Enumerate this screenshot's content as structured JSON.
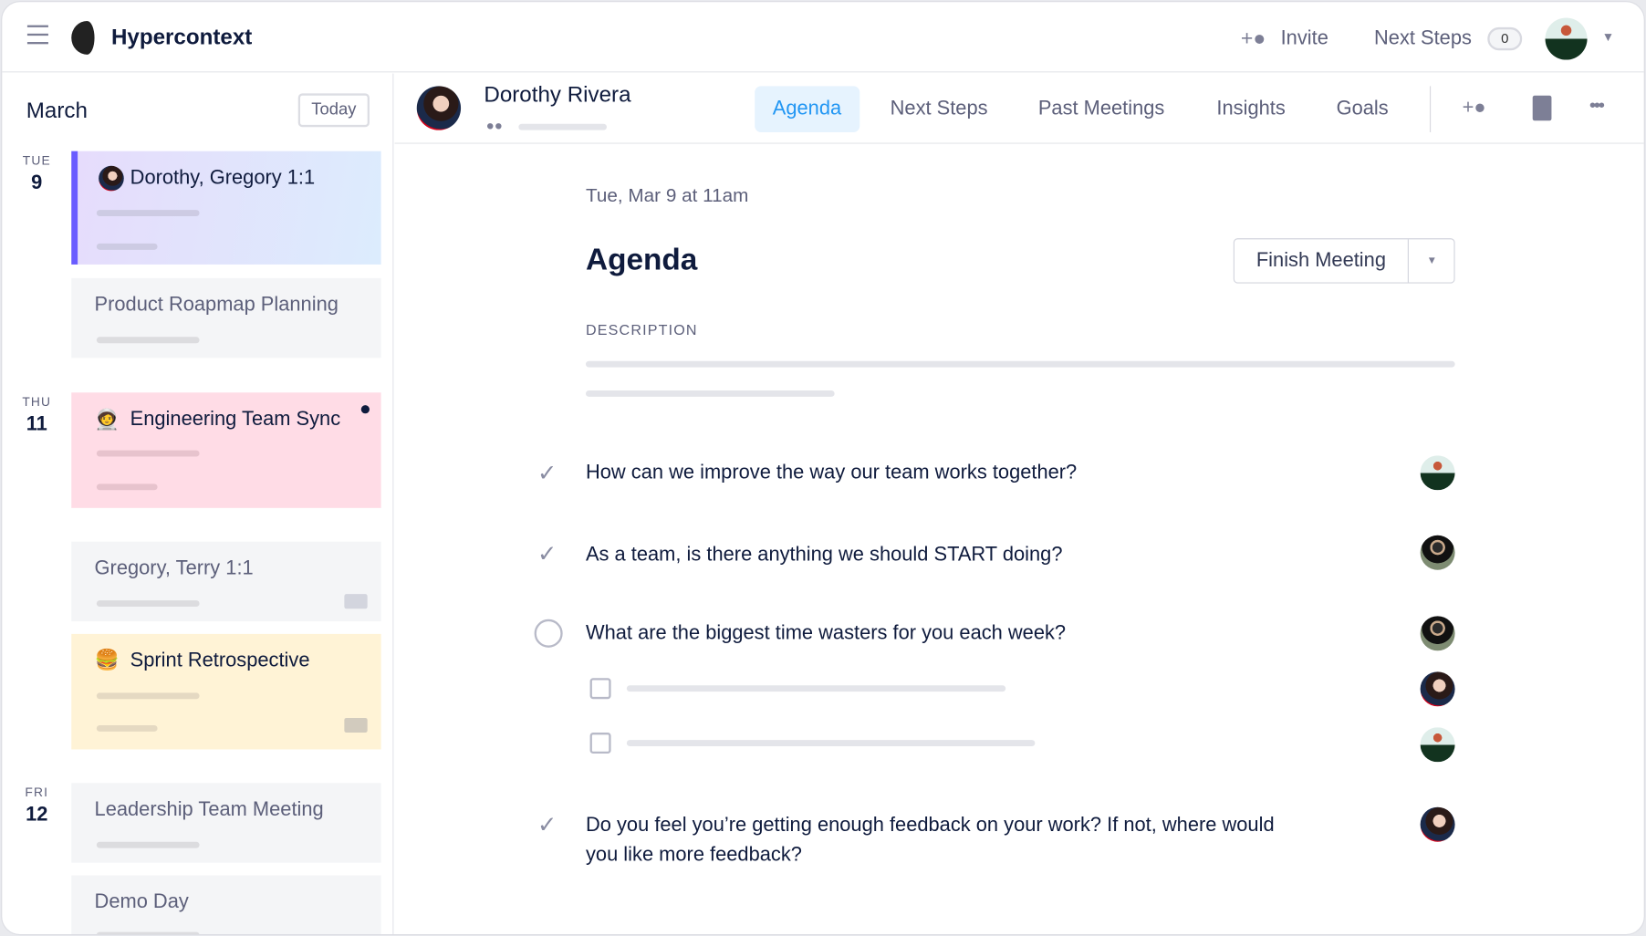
{
  "app": {
    "name": "Hypercontext"
  },
  "header": {
    "invite_label": "Invite",
    "next_steps_label": "Next Steps",
    "next_steps_count": "0"
  },
  "sidebar": {
    "month": "March",
    "today_label": "Today",
    "days": [
      {
        "dow": "TUE",
        "num": "9"
      },
      {
        "dow": "THU",
        "num": "11"
      },
      {
        "dow": "FRI",
        "num": "12"
      }
    ],
    "meetings": [
      {
        "title": "Dorothy, Gregory 1:1",
        "icon": "avatar"
      },
      {
        "title": "Product Roapmap Planning"
      },
      {
        "title": "Engineering Team Sync",
        "emoji": "🧑‍🚀",
        "unread": true
      },
      {
        "title": "Gregory, Terry 1:1",
        "video": true
      },
      {
        "title": "Sprint Retrospective",
        "emoji": "🍔",
        "video": true
      },
      {
        "title": "Leadership Team Meeting"
      },
      {
        "title": "Demo Day"
      }
    ]
  },
  "meeting": {
    "person": "Dorothy Rivera",
    "tabs": [
      {
        "label": "Agenda",
        "active": true
      },
      {
        "label": "Next Steps"
      },
      {
        "label": "Past Meetings"
      },
      {
        "label": "Insights"
      },
      {
        "label": "Goals"
      }
    ],
    "date": "Tue, Mar 9 at 11am",
    "title": "Agenda",
    "finish_label": "Finish Meeting",
    "description_label": "DESCRIPTION",
    "items": [
      {
        "text": "How can we improve the way our team works together?",
        "status": "done"
      },
      {
        "text": "As a team, is there anything we should START doing?",
        "status": "done"
      },
      {
        "text": "What are the biggest time wasters for you each week?",
        "status": "open"
      },
      {
        "text": "Do you feel you’re getting enough feedback on your work? If not, where would you like more feedback?",
        "status": "done"
      }
    ]
  },
  "colors": {
    "accent": "#2196f3",
    "text": "#0f1b3d",
    "muted": "#5c5f7a"
  }
}
